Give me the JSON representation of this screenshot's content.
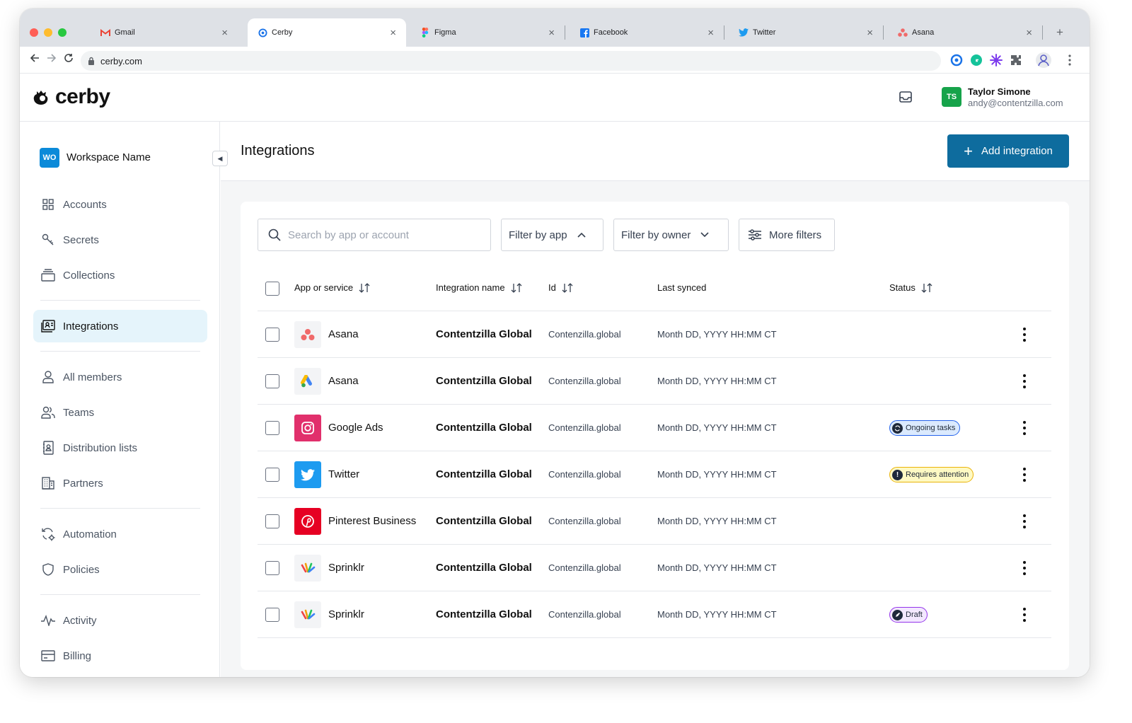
{
  "browser": {
    "tabs": [
      {
        "label": "Gmail",
        "icon": "gmail-icon"
      },
      {
        "label": "Cerby",
        "icon": "cerby-icon"
      },
      {
        "label": "Figma",
        "icon": "figma-icon"
      },
      {
        "label": "Facebook",
        "icon": "facebook-icon"
      },
      {
        "label": "Twitter",
        "icon": "twitter-icon"
      },
      {
        "label": "Asana",
        "icon": "asana-icon"
      }
    ],
    "url": "cerby.com"
  },
  "header": {
    "logo_text": "cerby",
    "user": {
      "initials": "TS",
      "name": "Taylor Simone",
      "email": "andy@contentzilla.com"
    }
  },
  "sidebar": {
    "workspace": {
      "initials": "WO",
      "name": "Workspace Name"
    },
    "items": [
      {
        "label": "Accounts",
        "icon": "grid-icon"
      },
      {
        "label": "Secrets",
        "icon": "key-icon"
      },
      {
        "label": "Collections",
        "icon": "stack-icon"
      },
      {
        "label": "Integrations",
        "icon": "integrations-icon",
        "active": true
      },
      {
        "label": "All members",
        "icon": "user-icon"
      },
      {
        "label": "Teams",
        "icon": "users-icon"
      },
      {
        "label": "Distribution lists",
        "icon": "contact-book-icon"
      },
      {
        "label": "Partners",
        "icon": "building-icon"
      },
      {
        "label": "Automation",
        "icon": "automation-icon"
      },
      {
        "label": "Policies",
        "icon": "shield-icon"
      },
      {
        "label": "Activity",
        "icon": "activity-icon"
      },
      {
        "label": "Billing",
        "icon": "credit-card-icon"
      }
    ]
  },
  "main": {
    "title": "Integrations",
    "add_button": "Add integration",
    "search_placeholder": "Search by app or account",
    "filters": {
      "by_app": "Filter by app",
      "by_owner": "Filter by owner",
      "more": "More filters"
    },
    "columns": {
      "app": "App or service",
      "integration": "Integration name",
      "id": "Id",
      "synced": "Last synced",
      "status": "Status"
    },
    "rows": [
      {
        "app": "Asana",
        "integration": "Contentzilla Global",
        "id": "Contenzilla.global",
        "synced": "Month DD, YYYY HH:MM CT",
        "status": ""
      },
      {
        "app": "Asana",
        "integration": "Contentzilla Global",
        "id": "Contenzilla.global",
        "synced": "Month DD, YYYY HH:MM CT",
        "status": ""
      },
      {
        "app": "Google Ads",
        "integration": "Contentzilla Global",
        "id": "Contenzilla.global",
        "synced": "Month DD, YYYY HH:MM CT",
        "status": "Ongoing tasks"
      },
      {
        "app": "Twitter",
        "integration": "Contentzilla Global",
        "id": "Contenzilla.global",
        "synced": "Month DD, YYYY HH:MM CT",
        "status": "Requires attention"
      },
      {
        "app": "Pinterest Business",
        "integration": "Contentzilla Global",
        "id": "Contenzilla.global",
        "synced": "Month DD, YYYY HH:MM CT",
        "status": ""
      },
      {
        "app": "Sprinklr",
        "integration": "Contentzilla Global",
        "id": "Contenzilla.global",
        "synced": "Month DD, YYYY HH:MM CT",
        "status": ""
      },
      {
        "app": "Sprinklr",
        "integration": "Contentzilla Global",
        "id": "Contenzilla.global",
        "synced": "Month DD, YYYY HH:MM CT",
        "status": "Draft"
      }
    ]
  },
  "colors": {
    "primary": "#0e6c9e",
    "nav_active_bg": "#e5f4fb",
    "status_ongoing": "#dbeafe",
    "status_attention": "#fef9c3",
    "status_draft": "#f3e8ff"
  }
}
